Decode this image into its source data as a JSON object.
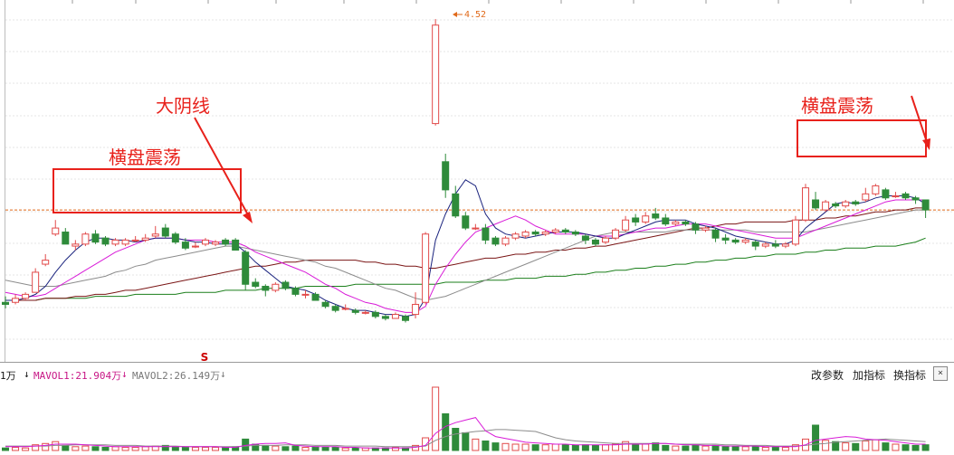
{
  "colors": {
    "up": "#e24b4b",
    "down": "#2e8b3a",
    "ma5": "#1a237e",
    "ma10": "#d81bd8",
    "ma20": "#8c8c8c",
    "ma60": "#7a1515",
    "ma120": "#1b7f1b",
    "ref": "#e06a1a",
    "note": "#e8211b"
  },
  "vol_header": {
    "vol_partial": "1万",
    "mavol1": "MAVOL1:21.904万",
    "mavol2": "MAVOL2:26.149万",
    "buttons": [
      "改参数",
      "加指标",
      "换指标"
    ],
    "close": "×"
  },
  "annotations": {
    "big_yin": "大阴线",
    "sideways_left": "横盘震荡",
    "sideways_right": "横盘震荡",
    "high_label": "4.52",
    "signal_mark": "S"
  },
  "chart_data": {
    "type": "candlestick",
    "candles": [
      [
        3.11,
        3.1,
        3.14,
        3.08
      ],
      [
        3.11,
        3.13,
        3.15,
        3.1
      ],
      [
        3.13,
        3.15,
        3.16,
        3.12
      ],
      [
        3.16,
        3.26,
        3.28,
        3.16
      ],
      [
        3.3,
        3.32,
        3.35,
        3.29
      ],
      [
        3.45,
        3.48,
        3.52,
        3.44
      ],
      [
        3.46,
        3.4,
        3.48,
        3.4
      ],
      [
        3.39,
        3.4,
        3.42,
        3.37
      ],
      [
        3.4,
        3.45,
        3.46,
        3.39
      ],
      [
        3.45,
        3.41,
        3.47,
        3.4
      ],
      [
        3.43,
        3.4,
        3.44,
        3.39
      ],
      [
        3.4,
        3.42,
        3.43,
        3.39
      ],
      [
        3.4,
        3.42,
        3.43,
        3.39
      ],
      [
        3.42,
        3.42,
        3.44,
        3.41
      ],
      [
        3.42,
        3.43,
        3.45,
        3.41
      ],
      [
        3.44,
        3.45,
        3.49,
        3.43
      ],
      [
        3.48,
        3.44,
        3.5,
        3.43
      ],
      [
        3.45,
        3.41,
        3.46,
        3.4
      ],
      [
        3.41,
        3.38,
        3.43,
        3.37
      ],
      [
        3.39,
        3.39,
        3.41,
        3.38
      ],
      [
        3.4,
        3.42,
        3.43,
        3.39
      ],
      [
        3.4,
        3.41,
        3.42,
        3.39
      ],
      [
        3.42,
        3.4,
        3.43,
        3.39
      ],
      [
        3.42,
        3.37,
        3.43,
        3.37
      ],
      [
        3.36,
        3.2,
        3.37,
        3.17
      ],
      [
        3.21,
        3.19,
        3.23,
        3.18
      ],
      [
        3.19,
        3.17,
        3.2,
        3.14
      ],
      [
        3.17,
        3.2,
        3.21,
        3.16
      ],
      [
        3.21,
        3.18,
        3.22,
        3.17
      ],
      [
        3.18,
        3.15,
        3.19,
        3.14
      ],
      [
        3.15,
        3.15,
        3.17,
        3.13
      ],
      [
        3.15,
        3.12,
        3.16,
        3.12
      ],
      [
        3.11,
        3.09,
        3.12,
        3.08
      ],
      [
        3.09,
        3.07,
        3.1,
        3.06
      ],
      [
        3.08,
        3.08,
        3.1,
        3.07
      ],
      [
        3.07,
        3.06,
        3.08,
        3.05
      ],
      [
        3.06,
        3.06,
        3.07,
        3.05
      ],
      [
        3.06,
        3.04,
        3.07,
        3.03
      ],
      [
        3.04,
        3.03,
        3.05,
        3.02
      ],
      [
        3.03,
        3.05,
        3.06,
        3.03
      ],
      [
        3.04,
        3.02,
        3.05,
        3.01
      ],
      [
        3.05,
        3.1,
        3.16,
        3.03
      ],
      [
        3.11,
        3.45,
        3.46,
        3.1
      ],
      [
        4.0,
        4.49,
        4.52,
        3.99
      ],
      [
        3.81,
        3.67,
        3.85,
        3.63
      ],
      [
        3.65,
        3.54,
        3.69,
        3.53
      ],
      [
        3.54,
        3.48,
        3.56,
        3.47
      ],
      [
        3.48,
        3.48,
        3.5,
        3.47
      ],
      [
        3.48,
        3.42,
        3.5,
        3.4
      ],
      [
        3.43,
        3.4,
        3.44,
        3.39
      ],
      [
        3.4,
        3.43,
        3.44,
        3.39
      ],
      [
        3.43,
        3.45,
        3.46,
        3.42
      ],
      [
        3.44,
        3.46,
        3.47,
        3.43
      ],
      [
        3.46,
        3.45,
        3.47,
        3.44
      ],
      [
        3.45,
        3.46,
        3.47,
        3.44
      ],
      [
        3.46,
        3.47,
        3.48,
        3.45
      ],
      [
        3.47,
        3.46,
        3.48,
        3.45
      ],
      [
        3.46,
        3.45,
        3.47,
        3.44
      ],
      [
        3.44,
        3.42,
        3.45,
        3.4
      ],
      [
        3.42,
        3.4,
        3.43,
        3.39
      ],
      [
        3.41,
        3.43,
        3.44,
        3.4
      ],
      [
        3.43,
        3.47,
        3.48,
        3.42
      ],
      [
        3.47,
        3.52,
        3.54,
        3.46
      ],
      [
        3.53,
        3.51,
        3.55,
        3.49
      ],
      [
        3.51,
        3.54,
        3.56,
        3.5
      ],
      [
        3.55,
        3.53,
        3.58,
        3.52
      ],
      [
        3.53,
        3.5,
        3.55,
        3.49
      ],
      [
        3.5,
        3.51,
        3.52,
        3.49
      ],
      [
        3.51,
        3.5,
        3.52,
        3.49
      ],
      [
        3.5,
        3.47,
        3.51,
        3.45
      ],
      [
        3.47,
        3.48,
        3.49,
        3.46
      ],
      [
        3.47,
        3.43,
        3.48,
        3.41
      ],
      [
        3.43,
        3.42,
        3.45,
        3.4
      ],
      [
        3.42,
        3.41,
        3.43,
        3.4
      ],
      [
        3.41,
        3.42,
        3.43,
        3.4
      ],
      [
        3.41,
        3.39,
        3.42,
        3.37
      ],
      [
        3.39,
        3.4,
        3.41,
        3.38
      ],
      [
        3.4,
        3.39,
        3.42,
        3.38
      ],
      [
        3.39,
        3.4,
        3.41,
        3.38
      ],
      [
        3.4,
        3.52,
        3.54,
        3.39
      ],
      [
        3.52,
        3.68,
        3.7,
        3.51
      ],
      [
        3.62,
        3.58,
        3.66,
        3.57
      ],
      [
        3.57,
        3.61,
        3.62,
        3.56
      ],
      [
        3.6,
        3.59,
        3.61,
        3.58
      ],
      [
        3.59,
        3.61,
        3.62,
        3.58
      ],
      [
        3.61,
        3.6,
        3.62,
        3.59
      ],
      [
        3.62,
        3.65,
        3.68,
        3.61
      ],
      [
        3.65,
        3.69,
        3.7,
        3.64
      ],
      [
        3.67,
        3.63,
        3.68,
        3.62
      ],
      [
        3.64,
        3.64,
        3.66,
        3.63
      ],
      [
        3.65,
        3.63,
        3.66,
        3.62
      ],
      [
        3.63,
        3.62,
        3.64,
        3.6
      ],
      [
        3.62,
        3.57,
        3.62,
        3.53
      ]
    ],
    "ma5": [
      3.12,
      3.12,
      3.13,
      3.15,
      3.19,
      3.26,
      3.32,
      3.37,
      3.41,
      3.43,
      3.43,
      3.42,
      3.42,
      3.41,
      3.42,
      3.43,
      3.43,
      3.43,
      3.42,
      3.41,
      3.41,
      3.4,
      3.4,
      3.4,
      3.36,
      3.31,
      3.27,
      3.23,
      3.19,
      3.18,
      3.17,
      3.15,
      3.12,
      3.1,
      3.08,
      3.07,
      3.07,
      3.06,
      3.05,
      3.05,
      3.04,
      3.05,
      3.13,
      3.42,
      3.55,
      3.65,
      3.72,
      3.69,
      3.55,
      3.48,
      3.45,
      3.44,
      3.43,
      3.44,
      3.45,
      3.46,
      3.46,
      3.46,
      3.45,
      3.44,
      3.43,
      3.43,
      3.45,
      3.47,
      3.49,
      3.51,
      3.52,
      3.52,
      3.52,
      3.5,
      3.49,
      3.48,
      3.46,
      3.44,
      3.43,
      3.42,
      3.41,
      3.4,
      3.4,
      3.42,
      3.48,
      3.52,
      3.56,
      3.6,
      3.61,
      3.6,
      3.61,
      3.63,
      3.64,
      3.64,
      3.64,
      3.63,
      3.6
    ],
    "ma10": [
      3.16,
      3.15,
      3.14,
      3.14,
      3.15,
      3.18,
      3.21,
      3.24,
      3.27,
      3.3,
      3.33,
      3.36,
      3.38,
      3.4,
      3.42,
      3.43,
      3.43,
      3.43,
      3.42,
      3.42,
      3.42,
      3.41,
      3.41,
      3.41,
      3.39,
      3.36,
      3.34,
      3.32,
      3.3,
      3.28,
      3.26,
      3.23,
      3.2,
      3.18,
      3.15,
      3.13,
      3.11,
      3.1,
      3.08,
      3.07,
      3.06,
      3.06,
      3.09,
      3.2,
      3.28,
      3.35,
      3.41,
      3.46,
      3.48,
      3.5,
      3.52,
      3.54,
      3.52,
      3.49,
      3.47,
      3.45,
      3.45,
      3.45,
      3.45,
      3.44,
      3.44,
      3.44,
      3.45,
      3.46,
      3.47,
      3.48,
      3.48,
      3.49,
      3.5,
      3.5,
      3.5,
      3.49,
      3.48,
      3.47,
      3.46,
      3.45,
      3.44,
      3.43,
      3.43,
      3.43,
      3.45,
      3.47,
      3.49,
      3.51,
      3.53,
      3.55,
      3.57,
      3.59,
      3.61,
      3.62,
      3.62,
      3.62,
      3.62
    ],
    "ma20": [
      3.22,
      3.21,
      3.2,
      3.19,
      3.19,
      3.19,
      3.2,
      3.21,
      3.22,
      3.23,
      3.24,
      3.26,
      3.27,
      3.29,
      3.3,
      3.32,
      3.33,
      3.34,
      3.35,
      3.36,
      3.37,
      3.38,
      3.39,
      3.39,
      3.38,
      3.37,
      3.36,
      3.35,
      3.34,
      3.33,
      3.32,
      3.31,
      3.29,
      3.28,
      3.26,
      3.24,
      3.22,
      3.2,
      3.18,
      3.17,
      3.15,
      3.13,
      3.12,
      3.13,
      3.14,
      3.16,
      3.18,
      3.2,
      3.22,
      3.24,
      3.26,
      3.28,
      3.3,
      3.32,
      3.34,
      3.36,
      3.38,
      3.4,
      3.42,
      3.44,
      3.45,
      3.46,
      3.46,
      3.46,
      3.46,
      3.46,
      3.46,
      3.47,
      3.47,
      3.47,
      3.47,
      3.47,
      3.47,
      3.47,
      3.47,
      3.46,
      3.46,
      3.46,
      3.46,
      3.46,
      3.46,
      3.47,
      3.48,
      3.49,
      3.5,
      3.51,
      3.52,
      3.53,
      3.54,
      3.55,
      3.56,
      3.57,
      3.57
    ],
    "ma60": [
      3.12,
      3.12,
      3.12,
      3.12,
      3.13,
      3.13,
      3.13,
      3.14,
      3.14,
      3.15,
      3.15,
      3.16,
      3.17,
      3.17,
      3.18,
      3.19,
      3.2,
      3.21,
      3.22,
      3.23,
      3.24,
      3.25,
      3.26,
      3.27,
      3.28,
      3.29,
      3.29,
      3.3,
      3.31,
      3.31,
      3.32,
      3.32,
      3.32,
      3.32,
      3.32,
      3.32,
      3.31,
      3.31,
      3.3,
      3.3,
      3.29,
      3.29,
      3.28,
      3.28,
      3.29,
      3.3,
      3.31,
      3.32,
      3.33,
      3.33,
      3.34,
      3.35,
      3.35,
      3.36,
      3.36,
      3.37,
      3.37,
      3.38,
      3.38,
      3.39,
      3.39,
      3.4,
      3.41,
      3.42,
      3.43,
      3.44,
      3.45,
      3.46,
      3.47,
      3.48,
      3.48,
      3.49,
      3.5,
      3.5,
      3.51,
      3.51,
      3.51,
      3.51,
      3.51,
      3.52,
      3.52,
      3.52,
      3.53,
      3.53,
      3.54,
      3.54,
      3.55,
      3.56,
      3.56,
      3.57,
      3.57,
      3.58,
      3.58
    ],
    "ma120": [
      3.12,
      3.12,
      3.12,
      3.12,
      3.13,
      3.13,
      3.13,
      3.13,
      3.13,
      3.14,
      3.14,
      3.14,
      3.14,
      3.15,
      3.15,
      3.15,
      3.15,
      3.15,
      3.16,
      3.16,
      3.16,
      3.16,
      3.17,
      3.17,
      3.17,
      3.17,
      3.18,
      3.18,
      3.18,
      3.18,
      3.19,
      3.19,
      3.19,
      3.19,
      3.19,
      3.2,
      3.2,
      3.2,
      3.2,
      3.2,
      3.2,
      3.2,
      3.2,
      3.2,
      3.21,
      3.21,
      3.21,
      3.21,
      3.22,
      3.22,
      3.22,
      3.23,
      3.23,
      3.23,
      3.24,
      3.24,
      3.24,
      3.25,
      3.25,
      3.26,
      3.26,
      3.27,
      3.27,
      3.28,
      3.28,
      3.29,
      3.29,
      3.3,
      3.3,
      3.31,
      3.31,
      3.32,
      3.32,
      3.33,
      3.33,
      3.34,
      3.34,
      3.35,
      3.35,
      3.35,
      3.36,
      3.36,
      3.37,
      3.37,
      3.38,
      3.38,
      3.38,
      3.39,
      3.39,
      3.39,
      3.4,
      3.41,
      3.43
    ],
    "reference_price": 3.57,
    "volume": [
      4,
      5,
      4,
      9,
      11,
      14,
      8,
      6,
      7,
      6,
      5,
      6,
      5,
      5,
      6,
      7,
      8,
      6,
      5,
      5,
      5,
      5,
      5,
      6,
      18,
      10,
      8,
      7,
      6,
      7,
      5,
      6,
      5,
      5,
      4,
      4,
      4,
      4,
      4,
      5,
      4,
      8,
      20,
      100,
      58,
      35,
      28,
      18,
      15,
      12,
      11,
      10,
      10,
      9,
      9,
      10,
      9,
      8,
      9,
      8,
      9,
      10,
      14,
      9,
      10,
      12,
      8,
      7,
      7,
      8,
      7,
      8,
      6,
      6,
      6,
      6,
      5,
      6,
      5,
      9,
      18,
      40,
      16,
      14,
      12,
      11,
      15,
      17,
      12,
      10,
      9,
      8,
      9
    ],
    "mavol1": [
      6,
      6,
      6,
      7,
      8,
      10,
      10,
      10,
      9,
      8,
      7,
      6,
      6,
      6,
      6,
      6,
      6,
      6,
      6,
      6,
      6,
      6,
      5,
      5,
      8,
      10,
      11,
      11,
      12,
      8,
      7,
      6,
      6,
      6,
      5,
      5,
      4,
      4,
      4,
      4,
      4,
      5,
      8,
      27,
      38,
      44,
      48,
      52,
      31,
      22,
      19,
      16,
      13,
      12,
      11,
      10,
      10,
      9,
      9,
      9,
      9,
      9,
      10,
      10,
      10,
      11,
      11,
      10,
      9,
      9,
      8,
      8,
      7,
      7,
      7,
      7,
      6,
      6,
      6,
      6,
      9,
      16,
      18,
      20,
      22,
      21,
      18,
      17,
      16,
      14,
      12,
      10,
      10
    ],
    "mavol2": [
      7,
      7,
      7,
      7,
      7,
      8,
      8,
      9,
      9,
      9,
      9,
      8,
      8,
      8,
      7,
      7,
      7,
      7,
      6,
      6,
      6,
      6,
      6,
      6,
      7,
      8,
      8,
      8,
      9,
      9,
      9,
      8,
      8,
      8,
      7,
      7,
      7,
      7,
      6,
      6,
      6,
      6,
      7,
      16,
      22,
      26,
      28,
      30,
      31,
      33,
      33,
      32,
      31,
      30,
      25,
      20,
      17,
      15,
      14,
      13,
      12,
      11,
      11,
      11,
      11,
      11,
      11,
      10,
      10,
      10,
      10,
      10,
      9,
      9,
      8,
      8,
      8,
      7,
      7,
      7,
      8,
      10,
      11,
      13,
      14,
      15,
      16,
      17,
      18,
      17,
      16,
      15,
      14
    ],
    "ylim": [
      2.85,
      4.57
    ]
  }
}
